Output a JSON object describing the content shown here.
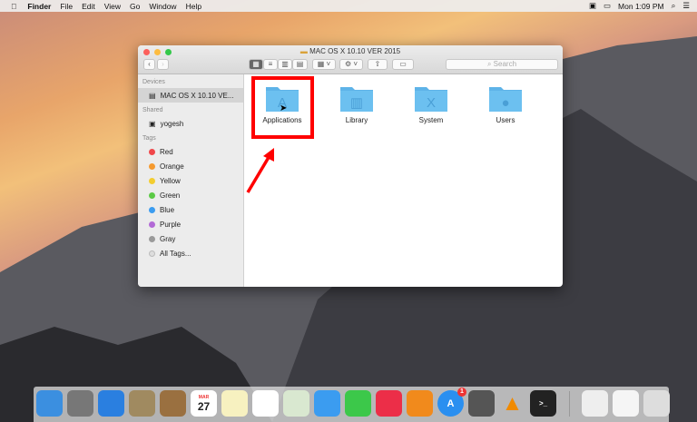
{
  "menubar": {
    "apple": "",
    "app": "Finder",
    "items": [
      "File",
      "Edit",
      "View",
      "Go",
      "Window",
      "Help"
    ],
    "clock": "Mon 1:09 PM"
  },
  "window": {
    "title": "MAC OS X 10.10 VER 2015",
    "search_placeholder": "Search",
    "sidebar": {
      "devices_header": "Devices",
      "device": "MAC OS X 10.10 VE...",
      "shared_header": "Shared",
      "shared": "yogesh",
      "tags_header": "Tags",
      "tags": [
        {
          "label": "Red",
          "color": "#f0474a"
        },
        {
          "label": "Orange",
          "color": "#f59a2f"
        },
        {
          "label": "Yellow",
          "color": "#f3cd30"
        },
        {
          "label": "Green",
          "color": "#5bc945"
        },
        {
          "label": "Blue",
          "color": "#3b9cf0"
        },
        {
          "label": "Purple",
          "color": "#b26ad6"
        },
        {
          "label": "Gray",
          "color": "#9a9a9a"
        }
      ],
      "all_tags": "All Tags..."
    },
    "folders": [
      {
        "label": "Applications",
        "glyph": "A"
      },
      {
        "label": "Library",
        "glyph": "▥"
      },
      {
        "label": "System",
        "glyph": "X"
      },
      {
        "label": "Users",
        "glyph": "●"
      }
    ]
  },
  "dock": {
    "calendar_month": "MAR",
    "calendar_day": "27",
    "appstore_badge": "1",
    "items": [
      "finder",
      "launchpad",
      "safari",
      "mail",
      "contacts",
      "calendar",
      "notes",
      "reminders",
      "maps",
      "messages",
      "facetime",
      "itunes",
      "ibooks",
      "app-store",
      "system-preferences",
      "vlc",
      "terminal",
      "drive",
      "document",
      "trash"
    ]
  },
  "colors": {
    "highlight": "#ff0000",
    "folder": "#6cc0f0"
  }
}
